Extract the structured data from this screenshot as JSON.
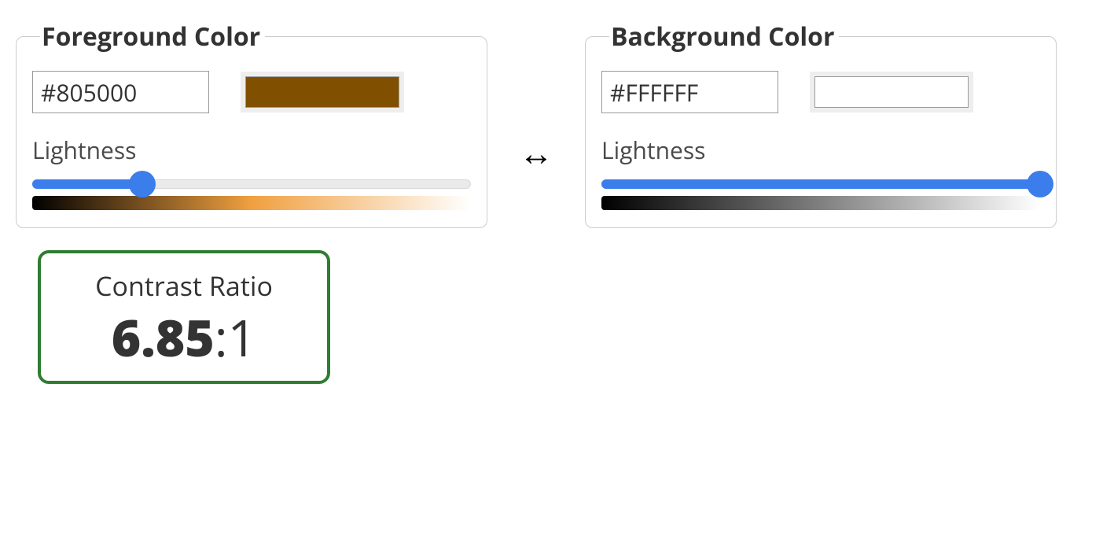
{
  "foreground": {
    "legend": "Foreground Color",
    "hex": "#805000",
    "swatchColor": "#805000",
    "lightnessLabel": "Lightness",
    "sliderPercent": 25,
    "gradientFrom": "#000000",
    "gradientMid": "#f0a040",
    "gradientTo": "#ffffff"
  },
  "background": {
    "legend": "Background Color",
    "hex": "#FFFFFF",
    "swatchColor": "#FFFFFF",
    "lightnessLabel": "Lightness",
    "sliderPercent": 100,
    "gradientFrom": "#000000",
    "gradientMid": "#808080",
    "gradientTo": "#ffffff"
  },
  "swapIcon": "↔",
  "contrast": {
    "title": "Contrast Ratio",
    "value": "6.85",
    "suffix": ":1",
    "borderColor": "#2e7d32"
  }
}
